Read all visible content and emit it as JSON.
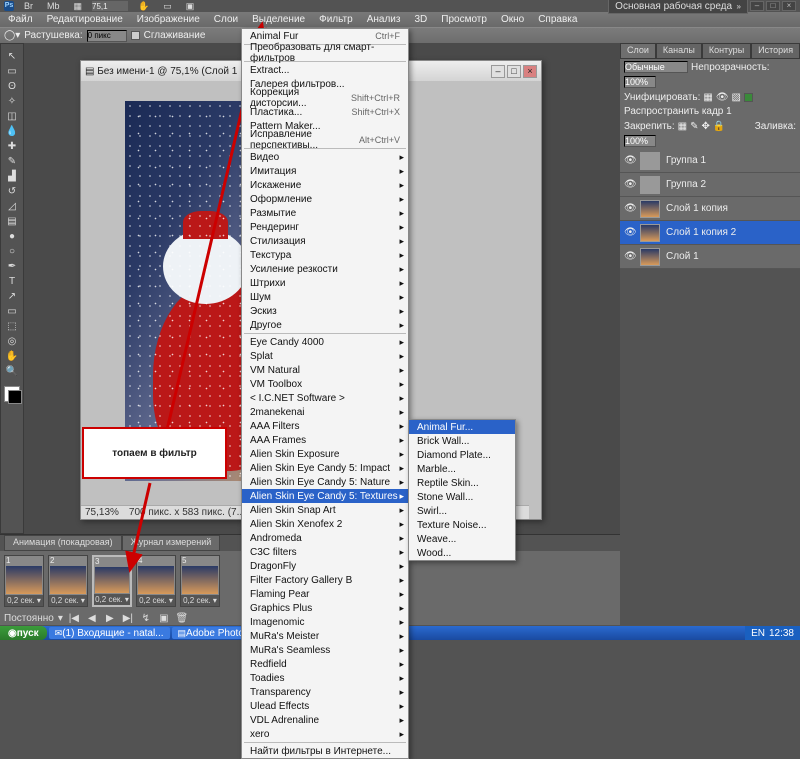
{
  "top": {
    "zoom_pct": "75,1",
    "workspace_label": "Основная рабочая среда"
  },
  "menu": [
    "Файл",
    "Редактирование",
    "Изображение",
    "Слои",
    "Выделение",
    "Фильтр",
    "Анализ",
    "3D",
    "Просмотр",
    "Окно",
    "Справка"
  ],
  "options": {
    "feather_label": "Растушевка:",
    "feather_val": "0 пикс",
    "anti_label": "Сглаживание"
  },
  "doc": {
    "title": "Без имени-1 @ 75,1% (Слой 1 ...)",
    "status_zoom": "75,13%",
    "status_dim": "700 пикс. x 583 пикс. (7..."
  },
  "annotation": {
    "text": "топаем в фильтр"
  },
  "filter_menu": {
    "last": "Animal Fur",
    "last_sc": "Ctrl+F",
    "smart": "Преобразовать для смарт-фильтров",
    "grpA": [
      {
        "l": "Extract..."
      },
      {
        "l": "Галерея фильтров..."
      },
      {
        "l": "Коррекция дисторсии...",
        "sc": "Shift+Ctrl+R"
      },
      {
        "l": "Пластика...",
        "sc": "Shift+Ctrl+X"
      },
      {
        "l": "Pattern Maker..."
      },
      {
        "l": "Исправление перспективы...",
        "sc": "Alt+Ctrl+V"
      }
    ],
    "grpB": [
      "Видео",
      "Имитация",
      "Искажение",
      "Оформление",
      "Размытие",
      "Рендеринг",
      "Стилизация",
      "Текстура",
      "Усиление резкости",
      "Штрихи",
      "Шум",
      "Эскиз",
      "Другое"
    ],
    "grpC": [
      "Eye Candy 4000",
      "Splat",
      "VM Natural",
      "VM Toolbox",
      "< I.C.NET Software >",
      "2manekenai",
      "AAA Filters",
      "AAA Frames",
      "Alien Skin Exposure",
      "Alien Skin Eye Candy 5: Impact",
      "Alien Skin Eye Candy 5: Nature",
      "Alien Skin Eye Candy 5: Textures",
      "Alien Skin Snap Art",
      "Alien Skin Xenofex 2",
      "Andromeda",
      "C3C filters",
      "DragonFly",
      "Filter Factory Gallery B",
      "Flaming Pear",
      "Graphics Plus",
      "Imagenomic",
      "MuRa's Meister",
      "MuRa's Seamless",
      "Redfield",
      "Toadies",
      "Transparency",
      "Ulead Effects",
      "VDL Adrenaline",
      "xero"
    ],
    "search": "Найти фильтры в Интернете...",
    "selected": "Alien Skin Eye Candy 5: Textures"
  },
  "submenu": {
    "items": [
      "Animal Fur...",
      "Brick Wall...",
      "Diamond Plate...",
      "Marble...",
      "Reptile Skin...",
      "Stone Wall...",
      "Swirl...",
      "Texture Noise...",
      "Weave...",
      "Wood..."
    ],
    "selected": "Animal Fur..."
  },
  "panels": {
    "tabs": [
      "Слои",
      "Каналы",
      "Контуры",
      "История"
    ],
    "blend": "Обычные",
    "opacity_label": "Непрозрачность:",
    "opacity": "100%",
    "unify": "Унифицировать:",
    "propagate": "Распространить кадр 1",
    "lock_label": "Закрепить:",
    "fill_label": "Заливка:",
    "fill": "100%",
    "layers": [
      {
        "name": "Группа 1",
        "folder": true
      },
      {
        "name": "Группа 2",
        "folder": true
      },
      {
        "name": "Слой 1 копия"
      },
      {
        "name": "Слой 1 копия 2",
        "sel": true
      },
      {
        "name": "Слой 1"
      }
    ]
  },
  "anim": {
    "tabs": [
      "Анимация (покадровая)",
      "Журнал измерений"
    ],
    "frames": [
      {
        "n": "1",
        "d": "0,2 сек."
      },
      {
        "n": "2",
        "d": "0,2 сек."
      },
      {
        "n": "3",
        "d": "0,2 сек."
      },
      {
        "n": "4",
        "d": "0,2 сек."
      },
      {
        "n": "5",
        "d": "0,2 сек."
      }
    ],
    "sel": 2,
    "loop": "Постоянно"
  },
  "taskbar": {
    "start": "пуск",
    "tasks": [
      "(1) Входящие - natal...",
      "Adobe Photoshop CS..."
    ],
    "lang": "EN",
    "time": "12:38"
  }
}
